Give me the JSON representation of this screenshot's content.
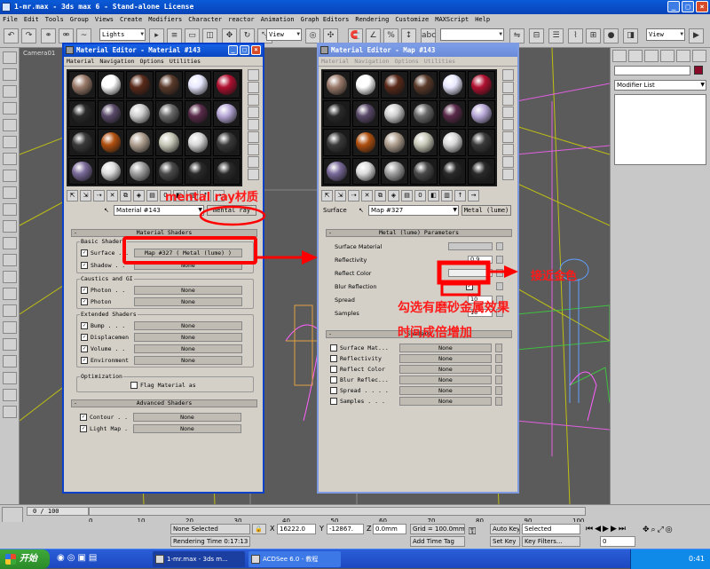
{
  "app": {
    "title": "1-mr.max - 3ds max 6 - Stand-alone License",
    "win_min": "_",
    "win_max": "□",
    "win_close": "×"
  },
  "menu": [
    "File",
    "Edit",
    "Tools",
    "Group",
    "Views",
    "Create",
    "Modifiers",
    "Character",
    "reactor",
    "Animation",
    "Graph Editors",
    "Rendering",
    "Customize",
    "MAXScript",
    "Help"
  ],
  "toolbar": {
    "selection_filter": "Lights",
    "ref_coord": "View",
    "ref_coord_right": "View"
  },
  "viewport": {
    "label": "Camera01"
  },
  "right_panel": {
    "modifier_list": "Modifier List"
  },
  "editor_left": {
    "title": "Material Editor - Material #143",
    "menu": [
      "Material",
      "Navigation",
      "Options",
      "Utilities"
    ],
    "material_name": "Material #143",
    "material_type": "mental ray",
    "rollout_material_shaders": "Material Shaders",
    "group_basic": "Basic Shaders",
    "surface_label": "Surface . .",
    "surface_value": "Map #327  ( Metal (lume) )",
    "shadow_label": "Shadow . .",
    "shadow_value": "None",
    "group_caustics": "Caustics and GI",
    "photon1_label": "Photon . .",
    "photon1_value": "None",
    "photon2_label": "Photon",
    "photon2_value": "None",
    "group_extended": "Extended Shaders",
    "bump_label": "Bump . . .",
    "bump_value": "None",
    "displace_label": "Displacemen",
    "displace_value": "None",
    "volume_label": "Volume . .",
    "volume_value": "None",
    "environment_label": "Environment",
    "environment_value": "None",
    "group_optimization": "Optimization",
    "flag_label": "Flag Material as",
    "rollout_advanced": "Advanced Shaders",
    "contour_label": "Contour . .",
    "contour_value": "None",
    "lightmap_label": "Light Map .",
    "lightmap_value": "None"
  },
  "editor_right": {
    "title": "Material Editor - Map #143",
    "menu": [
      "Material",
      "Navigation",
      "Options",
      "Utilities"
    ],
    "level_label": "Surface",
    "map_name": "Map #327",
    "map_type": "Metal (lume)",
    "rollout_params": "Metal (lume) Parameters",
    "surface_material": "Surface Material",
    "reflectivity": "Reflectivity",
    "reflectivity_value": "0.9",
    "reflect_color": "Reflect Color",
    "blur_reflection": "Blur Reflection",
    "spread": "Spread",
    "spread_value": "10",
    "samples": "Samples",
    "samples_value": "10",
    "rollout_shaders": "Shaders",
    "rows": [
      {
        "label": "Surface Mat...",
        "value": "None"
      },
      {
        "label": "Reflectivity",
        "value": "None"
      },
      {
        "label": "Reflect Color",
        "value": "None"
      },
      {
        "label": "Blur Reflec...",
        "value": "None"
      },
      {
        "label": "Spread . . . .",
        "value": "None"
      },
      {
        "label": "Samples . . .",
        "value": "None"
      }
    ]
  },
  "annotations": {
    "mental_ray": "mental ray材质",
    "connect": "接近金色",
    "line1": "勾选有磨砂金属效果",
    "line2": "时间成倍增加"
  },
  "timeline": {
    "slider": "0 / 100",
    "ticks": [
      "0",
      "10",
      "20",
      "30",
      "40",
      "50",
      "60",
      "70",
      "80",
      "90",
      "100"
    ]
  },
  "status": {
    "selected": "None Selected",
    "render_time": "Rendering Time  0:17:13",
    "x": "16222.0",
    "y": "-12867.",
    "z": "0.0mm",
    "grid": "Grid = 100.0mm",
    "add_time_tag": "Add Time Tag",
    "auto_key": "Auto Key",
    "selected_dd": "Selected",
    "set_key": "Set Key",
    "key_filters": "Key Filters...",
    "frame": "0"
  },
  "taskbar": {
    "start": "开始",
    "tasks": [
      "1-mr.max - 3ds m...",
      "ACDSee 6.0 - 教程"
    ],
    "clock": "0:41"
  }
}
